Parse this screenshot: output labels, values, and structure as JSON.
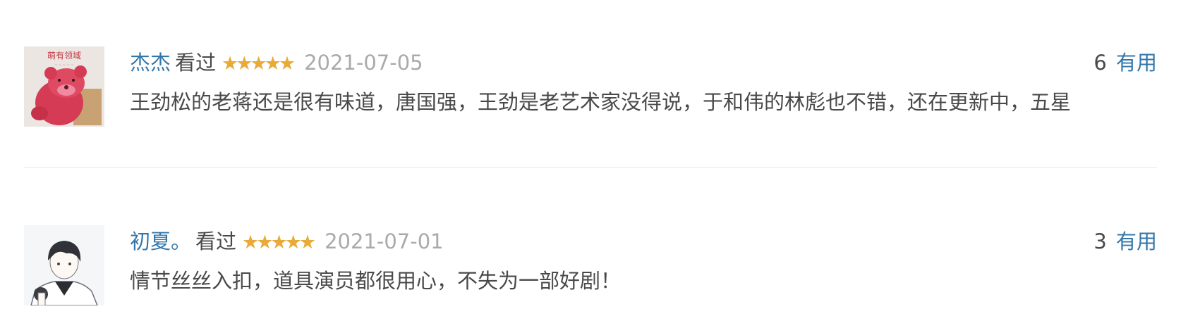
{
  "comments": [
    {
      "user": "杰杰",
      "status": "看过",
      "stars": "★★★★★",
      "rating_stars": 5,
      "date": "2021-07-05",
      "votes": "6",
      "useful_label": "有用",
      "text": "王劲松的老蒋还是很有味道，唐国强，王劲是老艺术家没得说，于和伟的林彪也不错，还在更新中，五星",
      "avatar_text": "萌有领域"
    },
    {
      "user": "初夏。",
      "status": "看过",
      "stars": "★★★★★",
      "rating_stars": 5,
      "date": "2021-07-01",
      "votes": "3",
      "useful_label": "有用",
      "text": "情节丝丝入扣，道具演员都很用心，不失为一部好剧！"
    }
  ],
  "colors": {
    "link": "#3377aa",
    "star": "#e8ab3a",
    "date": "#aaaaaa",
    "text": "#494949"
  }
}
